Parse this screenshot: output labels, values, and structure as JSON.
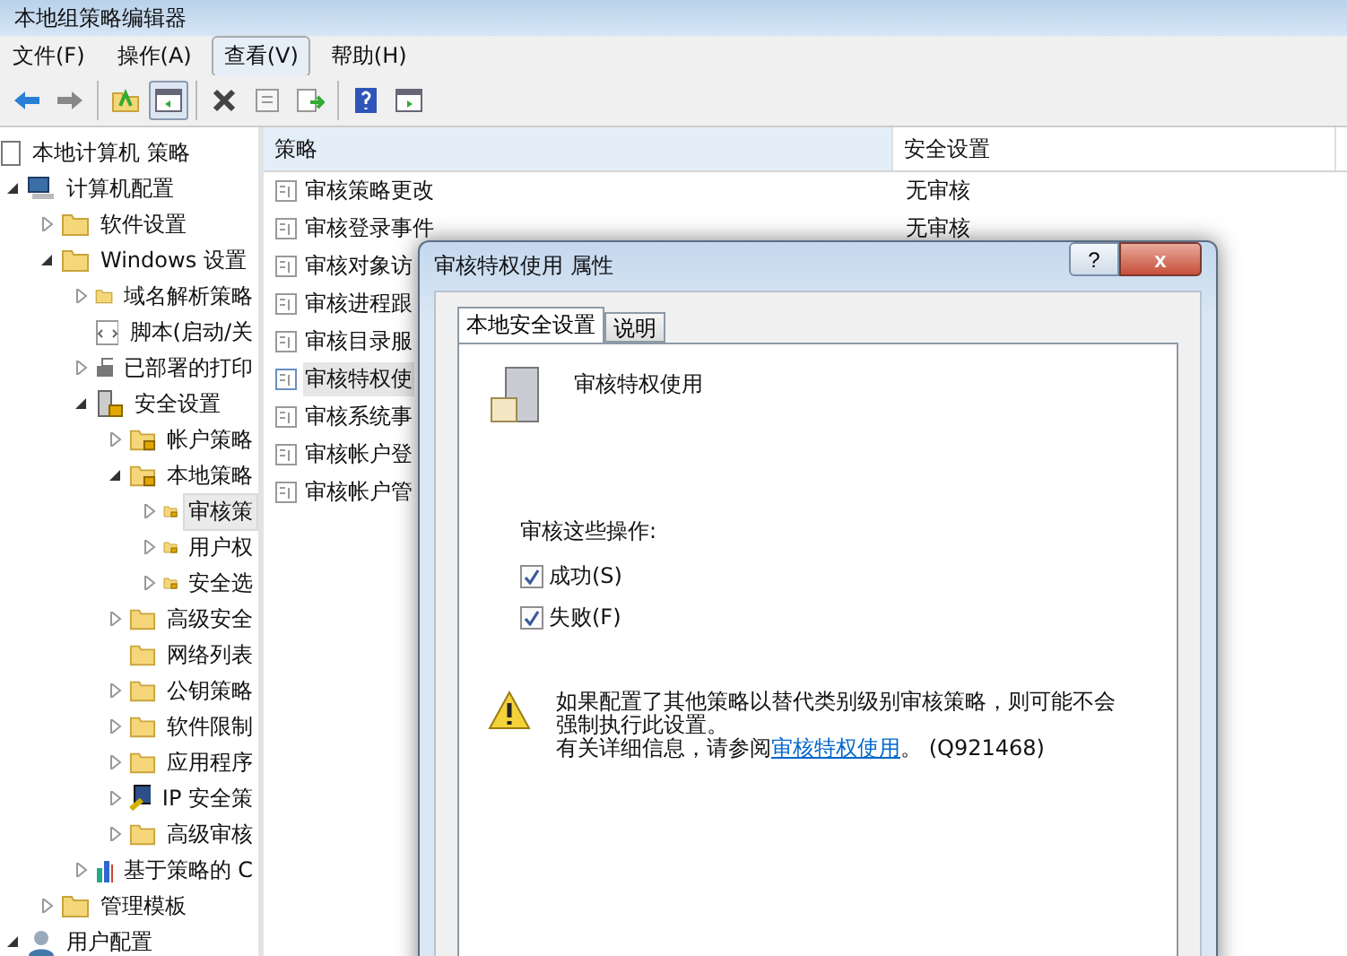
{
  "window": {
    "title": "本地组策略编辑器"
  },
  "menu": [
    {
      "label": "文件(F)",
      "highlighted": false
    },
    {
      "label": "操作(A)",
      "highlighted": false
    },
    {
      "label": "查看(V)",
      "highlighted": true
    },
    {
      "label": "帮助(H)",
      "highlighted": false
    }
  ],
  "toolbar": [
    [
      {
        "kind": "back",
        "pressed": false
      },
      {
        "kind": "forward",
        "pressed": false
      }
    ],
    [
      {
        "kind": "up",
        "pressed": false
      },
      {
        "kind": "tree",
        "pressed": true
      }
    ],
    [
      {
        "kind": "delete",
        "pressed": false
      },
      {
        "kind": "properties",
        "pressed": false
      },
      {
        "kind": "export",
        "pressed": false
      }
    ],
    [
      {
        "kind": "help",
        "pressed": false
      },
      {
        "kind": "panel",
        "pressed": false
      }
    ]
  ],
  "tree": [
    {
      "label": "本地计算机 策略",
      "kind": "policy",
      "selected": false,
      "children": [
        {
          "label": "计算机配置",
          "kind": "computer",
          "expanded": true,
          "selected": false,
          "children": [
            {
              "label": "软件设置",
              "kind": "folder",
              "expanded": false,
              "selected": false
            },
            {
              "label": "Windows 设置",
              "kind": "folder",
              "expanded": true,
              "selected": false,
              "children": [
                {
                  "label": "域名解析策略",
                  "kind": "folder",
                  "expanded": false,
                  "selected": false
                },
                {
                  "label": "脚本(启动/关",
                  "kind": "script",
                  "selected": false
                },
                {
                  "label": "已部署的打印",
                  "kind": "printer",
                  "expanded": false,
                  "selected": false
                },
                {
                  "label": "安全设置",
                  "kind": "secure",
                  "expanded": true,
                  "selected": false,
                  "children": [
                    {
                      "label": "帐户策略",
                      "kind": "lockfolder",
                      "expanded": false,
                      "selected": false
                    },
                    {
                      "label": "本地策略",
                      "kind": "lockfolder",
                      "expanded": true,
                      "selected": false,
                      "children": [
                        {
                          "label": "审核策",
                          "kind": "lockfolder",
                          "expanded": false,
                          "selected": true
                        },
                        {
                          "label": "用户权",
                          "kind": "lockfolder",
                          "expanded": false,
                          "selected": false
                        },
                        {
                          "label": "安全选",
                          "kind": "lockfolder",
                          "expanded": false,
                          "selected": false
                        }
                      ]
                    },
                    {
                      "label": "高级安全",
                      "kind": "folder",
                      "expanded": false,
                      "selected": false
                    },
                    {
                      "label": "网络列表",
                      "kind": "folder",
                      "selected": false
                    },
                    {
                      "label": "公钥策略",
                      "kind": "folder",
                      "expanded": false,
                      "selected": false
                    },
                    {
                      "label": "软件限制",
                      "kind": "folder",
                      "expanded": false,
                      "selected": false
                    },
                    {
                      "label": "应用程序",
                      "kind": "folder",
                      "expanded": false,
                      "selected": false
                    },
                    {
                      "label": "IP 安全策",
                      "kind": "ip",
                      "expanded": false,
                      "selected": false
                    },
                    {
                      "label": "高级审核",
                      "kind": "folder",
                      "expanded": false,
                      "selected": false
                    }
                  ]
                },
                {
                  "label": "基于策略的 C",
                  "kind": "chart",
                  "expanded": false,
                  "selected": false
                }
              ]
            },
            {
              "label": "管理模板",
              "kind": "folder",
              "expanded": false,
              "selected": false
            }
          ]
        },
        {
          "label": "用户配置",
          "kind": "user",
          "expanded": true,
          "selected": false
        }
      ]
    }
  ],
  "table": {
    "columns": [
      "策略",
      "安全设置"
    ],
    "rows": [
      {
        "policy": "审核策略更改",
        "setting": "无审核",
        "selected": false
      },
      {
        "policy": "审核登录事件",
        "setting": "无审核",
        "selected": false
      },
      {
        "policy": "审核对象访",
        "selected": false
      },
      {
        "policy": "审核进程跟",
        "selected": false
      },
      {
        "policy": "审核目录服",
        "selected": false
      },
      {
        "policy": "审核特权使",
        "selected": true
      },
      {
        "policy": "审核系统事",
        "selected": false
      },
      {
        "policy": "审核帐户登",
        "selected": false
      },
      {
        "policy": "审核帐户管",
        "selected": false
      }
    ]
  },
  "dialog": {
    "title": "审核特权使用 属性",
    "help_button": "?",
    "close_button": "x",
    "tabs": [
      {
        "label": "本地安全设置",
        "selected": true
      },
      {
        "label": "说明",
        "selected": false
      }
    ],
    "heading": "审核特权使用",
    "group_label": "审核这些操作:",
    "options": [
      {
        "label": "成功(S)",
        "checked": true
      },
      {
        "label": "失败(F)",
        "checked": true
      }
    ],
    "warning_lines": [
      "如果配置了其他策略以替代类别级别审核策略，则可能不会",
      "强制执行此设置。"
    ],
    "info_prefix": "有关详细信息，请参阅",
    "info_link": "审核特权使用",
    "info_suffix": "。 (Q921468)"
  }
}
